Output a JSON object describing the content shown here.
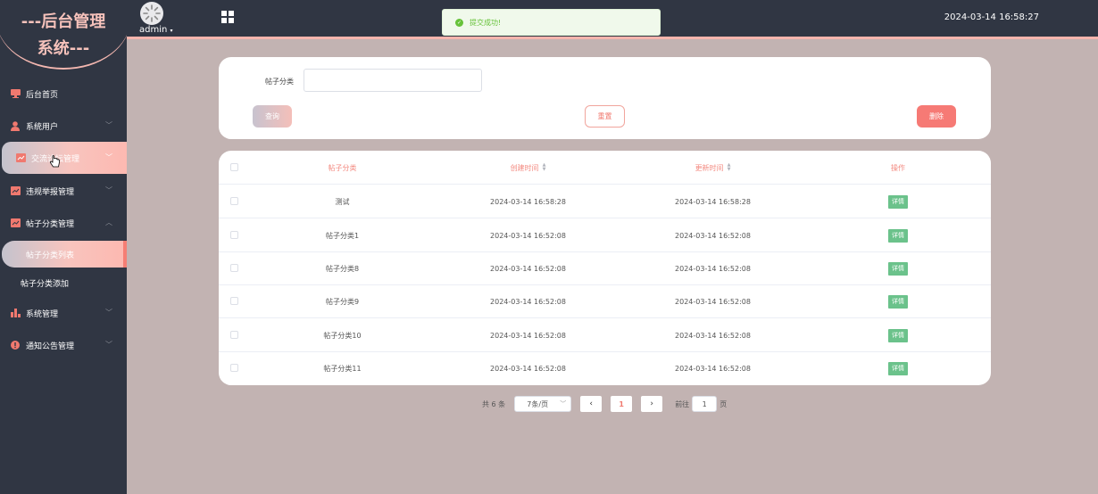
{
  "sidebar": {
    "logo_line1": "---后台管理",
    "logo_line2": "系统---",
    "items": [
      {
        "label": "后台首页",
        "icon": "monitor-icon"
      },
      {
        "label": "系统用户",
        "icon": "user-icon"
      },
      {
        "label": "交流论坛管理",
        "icon": "chart-icon"
      },
      {
        "label": "违规举报管理",
        "icon": "chart-icon"
      },
      {
        "label": "帖子分类管理",
        "icon": "chart-icon"
      },
      {
        "label": "系统管理",
        "icon": "bar-chart-icon"
      },
      {
        "label": "通知公告管理",
        "icon": "info-icon"
      }
    ],
    "sub_items": [
      {
        "label": "帖子分类列表"
      },
      {
        "label": "帖子分类添加"
      }
    ]
  },
  "header": {
    "user": "admin",
    "datetime": "2024-03-14 16:58:27"
  },
  "toast": {
    "message": "提交成功!"
  },
  "search": {
    "label": "帖子分类",
    "value": "",
    "query_label": "查询",
    "reset_label": "重置",
    "delete_label": "删除"
  },
  "table": {
    "columns": [
      "帖子分类",
      "创建时间",
      "更新时间",
      "操作"
    ],
    "detail_label": "详情",
    "rows": [
      {
        "name": "测试",
        "created": "2024-03-14 16:58:28",
        "updated": "2024-03-14 16:58:28"
      },
      {
        "name": "帖子分类1",
        "created": "2024-03-14 16:52:08",
        "updated": "2024-03-14 16:52:08"
      },
      {
        "name": "帖子分类8",
        "created": "2024-03-14 16:52:08",
        "updated": "2024-03-14 16:52:08"
      },
      {
        "name": "帖子分类9",
        "created": "2024-03-14 16:52:08",
        "updated": "2024-03-14 16:52:08"
      },
      {
        "name": "帖子分类10",
        "created": "2024-03-14 16:52:08",
        "updated": "2024-03-14 16:52:08"
      },
      {
        "name": "帖子分类11",
        "created": "2024-03-14 16:52:08",
        "updated": "2024-03-14 16:52:08"
      }
    ]
  },
  "pagination": {
    "total": "共 6 条",
    "page_size": "7条/页",
    "current": "1",
    "goto_label": "前往",
    "goto_value": "1",
    "page_suffix": "页"
  },
  "colors": {
    "sidebar_bg": "#303643",
    "accent": "#f0796f",
    "content_bg": "#c2b3b2",
    "detail_btn": "#6bc28b"
  }
}
